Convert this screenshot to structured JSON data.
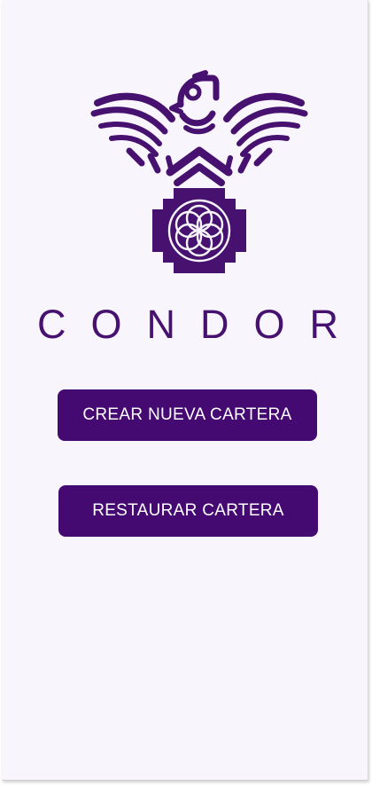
{
  "app": {
    "name": "CONDOR",
    "brand_color": "#450a72",
    "background_color": "#f9f5fd",
    "logo_icon": "condor-chakana-logo-icon"
  },
  "actions": {
    "create_wallet_label": "CREAR NUEVA CARTERA",
    "restore_wallet_label": "RESTAURAR CARTERA"
  }
}
